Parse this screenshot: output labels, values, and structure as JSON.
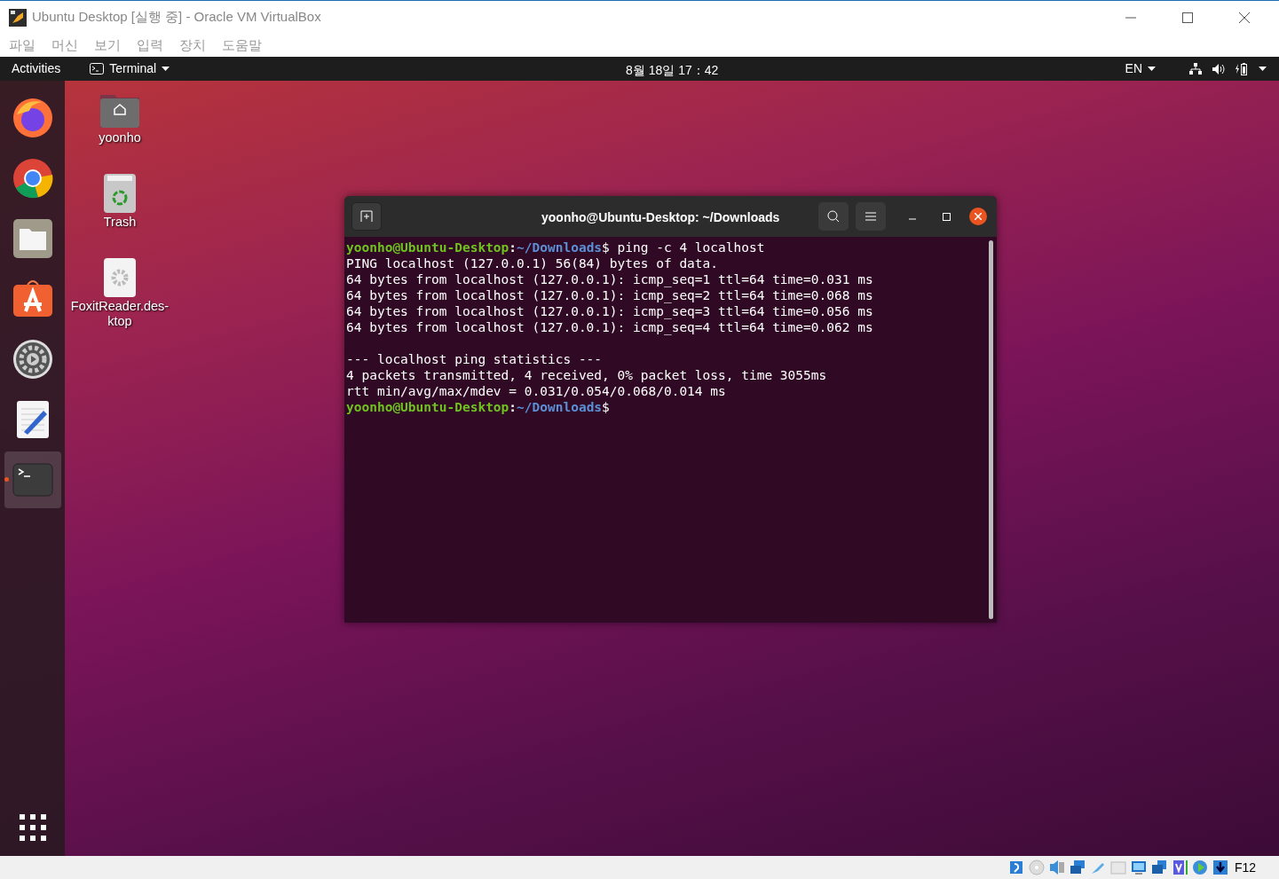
{
  "window": {
    "title": "Ubuntu Desktop [실행 중] - Oracle VM VirtualBox"
  },
  "menu": [
    "파일",
    "머신",
    "보기",
    "입력",
    "장치",
    "도움말"
  ],
  "top_bar": {
    "activities": "Activities",
    "app": "Terminal",
    "clock": "8월 18일  17：42",
    "language": "EN"
  },
  "dock": [
    {
      "kind": "firefox",
      "selected": false
    },
    {
      "kind": "chrome",
      "selected": false
    },
    {
      "kind": "files",
      "selected": false
    },
    {
      "kind": "store",
      "selected": false
    },
    {
      "kind": "settings",
      "selected": false
    },
    {
      "kind": "editor",
      "selected": false
    },
    {
      "kind": "terminal",
      "selected": true
    }
  ],
  "desktop_icons": [
    {
      "kind": "home",
      "label": "yoonho"
    },
    {
      "kind": "trash",
      "label": "Trash"
    },
    {
      "kind": "launcher",
      "label": "FoxitReader.des-\nktop"
    }
  ],
  "terminal": {
    "title": "yoonho@Ubuntu-Desktop: ~/Downloads",
    "lines": [
      {
        "kind": "prompt",
        "user_host": "yoonho@Ubuntu-Desktop",
        "separator": ":",
        "path": "~/Downloads",
        "command": "$ ping -c 4 localhost"
      },
      {
        "kind": "output",
        "text": "PING localhost (127.0.0.1) 56(84) bytes of data."
      },
      {
        "kind": "output",
        "text": "64 bytes from localhost (127.0.0.1): icmp_seq=1 ttl=64 time=0.031 ms"
      },
      {
        "kind": "output",
        "text": "64 bytes from localhost (127.0.0.1): icmp_seq=2 ttl=64 time=0.068 ms"
      },
      {
        "kind": "output",
        "text": "64 bytes from localhost (127.0.0.1): icmp_seq=3 ttl=64 time=0.056 ms"
      },
      {
        "kind": "output",
        "text": "64 bytes from localhost (127.0.0.1): icmp_seq=4 ttl=64 time=0.062 ms"
      },
      {
        "kind": "blank"
      },
      {
        "kind": "output",
        "text": "--- localhost ping statistics ---"
      },
      {
        "kind": "output",
        "text": "4 packets transmitted, 4 received, 0% packet loss, time 3055ms"
      },
      {
        "kind": "output",
        "text": "rtt min/avg/max/mdev = 0.031/0.054/0.068/0.014 ms"
      },
      {
        "kind": "prompt",
        "user_host": "yoonho@Ubuntu-Desktop",
        "separator": ":",
        "path": "~/Downloads",
        "command": "$"
      }
    ]
  },
  "status_bar": {
    "host_key": "F12"
  }
}
